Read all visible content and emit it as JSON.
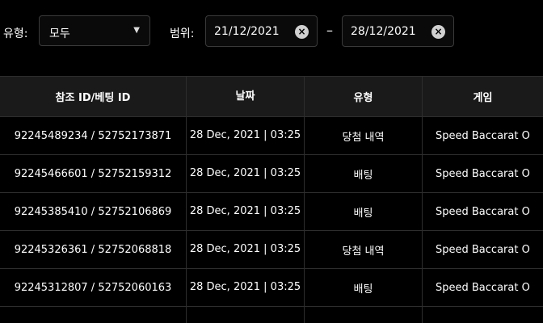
{
  "filters": {
    "type_label": "유형:",
    "type_value": "모두",
    "range_label": "범위:",
    "date_from": "21/12/2021",
    "date_to": "28/12/2021",
    "dash": "–"
  },
  "table": {
    "headers": [
      "참조 ID/베팅 ID",
      "날짜",
      "유형",
      "게임"
    ],
    "rows": [
      {
        "id": "92245489234 / 52752173871",
        "date": "28 Dec, 2021 | 03:25",
        "type": "당첨 내역",
        "game": "Speed Baccarat O"
      },
      {
        "id": "92245466601 / 52752159312",
        "date": "28 Dec, 2021 | 03:25",
        "type": "배팅",
        "game": "Speed Baccarat O"
      },
      {
        "id": "92245385410 / 52752106869",
        "date": "28 Dec, 2021 | 03:25",
        "type": "배팅",
        "game": "Speed Baccarat O"
      },
      {
        "id": "92245326361 / 52752068818",
        "date": "28 Dec, 2021 | 03:25",
        "type": "당첨 내역",
        "game": "Speed Baccarat O"
      },
      {
        "id": "92245312807 / 52752060163",
        "date": "28 Dec, 2021 | 03:25",
        "type": "배팅",
        "game": "Speed Baccarat O"
      }
    ]
  },
  "icons": {
    "clear": "clear-circle-icon",
    "caret": "caret-down-icon"
  }
}
